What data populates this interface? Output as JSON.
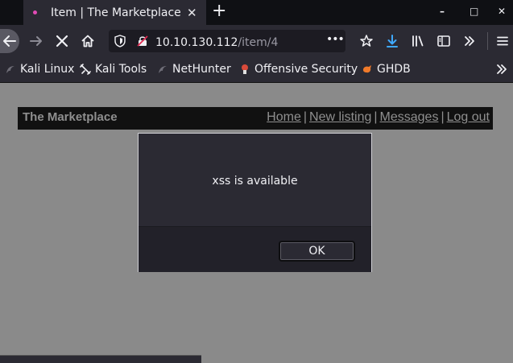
{
  "tab": {
    "title": "Item | The Marketplace"
  },
  "window": {
    "minimize": "–",
    "maximize": "□",
    "close": "✕"
  },
  "nav": {
    "url_host": "10.10.130.112",
    "url_path": "/item/4",
    "page_actions": "•••"
  },
  "bookmarks": [
    {
      "label": "Kali Linux",
      "icon": "kali-dragon-icon"
    },
    {
      "label": "Kali Tools",
      "icon": "kali-tools-icon"
    },
    {
      "label": "NetHunter",
      "icon": "nethunter-icon"
    },
    {
      "label": "Offensive Security",
      "icon": "offsec-icon"
    },
    {
      "label": "GHDB",
      "icon": "ghdb-icon"
    }
  ],
  "site": {
    "brand": "The Marketplace",
    "links": [
      {
        "label": "Home"
      },
      {
        "label": "New listing"
      },
      {
        "label": "Messages"
      },
      {
        "label": "Log out"
      }
    ],
    "separator": "|"
  },
  "dialog": {
    "message": "xss is available",
    "ok_label": "OK"
  },
  "colors": {
    "page_background": "#8a8a8a",
    "header_background": "#111111",
    "chrome_background": "#2b2a33",
    "tab_indicator": "#e24bb6",
    "download_icon": "#3fa9ff"
  }
}
